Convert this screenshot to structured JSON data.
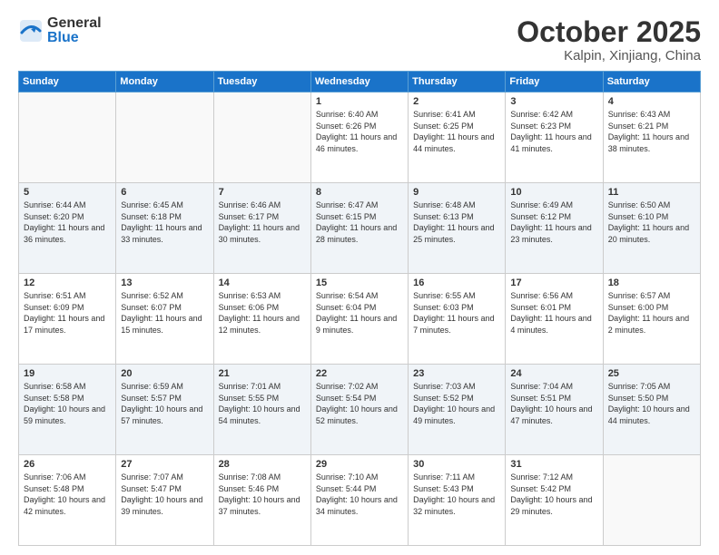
{
  "header": {
    "logo_general": "General",
    "logo_blue": "Blue",
    "month_title": "October 2025",
    "location": "Kalpin, Xinjiang, China"
  },
  "weekdays": [
    "Sunday",
    "Monday",
    "Tuesday",
    "Wednesday",
    "Thursday",
    "Friday",
    "Saturday"
  ],
  "weeks": [
    [
      {
        "day": "",
        "info": ""
      },
      {
        "day": "",
        "info": ""
      },
      {
        "day": "",
        "info": ""
      },
      {
        "day": "1",
        "info": "Sunrise: 6:40 AM\nSunset: 6:26 PM\nDaylight: 11 hours\nand 46 minutes."
      },
      {
        "day": "2",
        "info": "Sunrise: 6:41 AM\nSunset: 6:25 PM\nDaylight: 11 hours\nand 44 minutes."
      },
      {
        "day": "3",
        "info": "Sunrise: 6:42 AM\nSunset: 6:23 PM\nDaylight: 11 hours\nand 41 minutes."
      },
      {
        "day": "4",
        "info": "Sunrise: 6:43 AM\nSunset: 6:21 PM\nDaylight: 11 hours\nand 38 minutes."
      }
    ],
    [
      {
        "day": "5",
        "info": "Sunrise: 6:44 AM\nSunset: 6:20 PM\nDaylight: 11 hours\nand 36 minutes."
      },
      {
        "day": "6",
        "info": "Sunrise: 6:45 AM\nSunset: 6:18 PM\nDaylight: 11 hours\nand 33 minutes."
      },
      {
        "day": "7",
        "info": "Sunrise: 6:46 AM\nSunset: 6:17 PM\nDaylight: 11 hours\nand 30 minutes."
      },
      {
        "day": "8",
        "info": "Sunrise: 6:47 AM\nSunset: 6:15 PM\nDaylight: 11 hours\nand 28 minutes."
      },
      {
        "day": "9",
        "info": "Sunrise: 6:48 AM\nSunset: 6:13 PM\nDaylight: 11 hours\nand 25 minutes."
      },
      {
        "day": "10",
        "info": "Sunrise: 6:49 AM\nSunset: 6:12 PM\nDaylight: 11 hours\nand 23 minutes."
      },
      {
        "day": "11",
        "info": "Sunrise: 6:50 AM\nSunset: 6:10 PM\nDaylight: 11 hours\nand 20 minutes."
      }
    ],
    [
      {
        "day": "12",
        "info": "Sunrise: 6:51 AM\nSunset: 6:09 PM\nDaylight: 11 hours\nand 17 minutes."
      },
      {
        "day": "13",
        "info": "Sunrise: 6:52 AM\nSunset: 6:07 PM\nDaylight: 11 hours\nand 15 minutes."
      },
      {
        "day": "14",
        "info": "Sunrise: 6:53 AM\nSunset: 6:06 PM\nDaylight: 11 hours\nand 12 minutes."
      },
      {
        "day": "15",
        "info": "Sunrise: 6:54 AM\nSunset: 6:04 PM\nDaylight: 11 hours\nand 9 minutes."
      },
      {
        "day": "16",
        "info": "Sunrise: 6:55 AM\nSunset: 6:03 PM\nDaylight: 11 hours\nand 7 minutes."
      },
      {
        "day": "17",
        "info": "Sunrise: 6:56 AM\nSunset: 6:01 PM\nDaylight: 11 hours\nand 4 minutes."
      },
      {
        "day": "18",
        "info": "Sunrise: 6:57 AM\nSunset: 6:00 PM\nDaylight: 11 hours\nand 2 minutes."
      }
    ],
    [
      {
        "day": "19",
        "info": "Sunrise: 6:58 AM\nSunset: 5:58 PM\nDaylight: 10 hours\nand 59 minutes."
      },
      {
        "day": "20",
        "info": "Sunrise: 6:59 AM\nSunset: 5:57 PM\nDaylight: 10 hours\nand 57 minutes."
      },
      {
        "day": "21",
        "info": "Sunrise: 7:01 AM\nSunset: 5:55 PM\nDaylight: 10 hours\nand 54 minutes."
      },
      {
        "day": "22",
        "info": "Sunrise: 7:02 AM\nSunset: 5:54 PM\nDaylight: 10 hours\nand 52 minutes."
      },
      {
        "day": "23",
        "info": "Sunrise: 7:03 AM\nSunset: 5:52 PM\nDaylight: 10 hours\nand 49 minutes."
      },
      {
        "day": "24",
        "info": "Sunrise: 7:04 AM\nSunset: 5:51 PM\nDaylight: 10 hours\nand 47 minutes."
      },
      {
        "day": "25",
        "info": "Sunrise: 7:05 AM\nSunset: 5:50 PM\nDaylight: 10 hours\nand 44 minutes."
      }
    ],
    [
      {
        "day": "26",
        "info": "Sunrise: 7:06 AM\nSunset: 5:48 PM\nDaylight: 10 hours\nand 42 minutes."
      },
      {
        "day": "27",
        "info": "Sunrise: 7:07 AM\nSunset: 5:47 PM\nDaylight: 10 hours\nand 39 minutes."
      },
      {
        "day": "28",
        "info": "Sunrise: 7:08 AM\nSunset: 5:46 PM\nDaylight: 10 hours\nand 37 minutes."
      },
      {
        "day": "29",
        "info": "Sunrise: 7:10 AM\nSunset: 5:44 PM\nDaylight: 10 hours\nand 34 minutes."
      },
      {
        "day": "30",
        "info": "Sunrise: 7:11 AM\nSunset: 5:43 PM\nDaylight: 10 hours\nand 32 minutes."
      },
      {
        "day": "31",
        "info": "Sunrise: 7:12 AM\nSunset: 5:42 PM\nDaylight: 10 hours\nand 29 minutes."
      },
      {
        "day": "",
        "info": ""
      }
    ]
  ]
}
